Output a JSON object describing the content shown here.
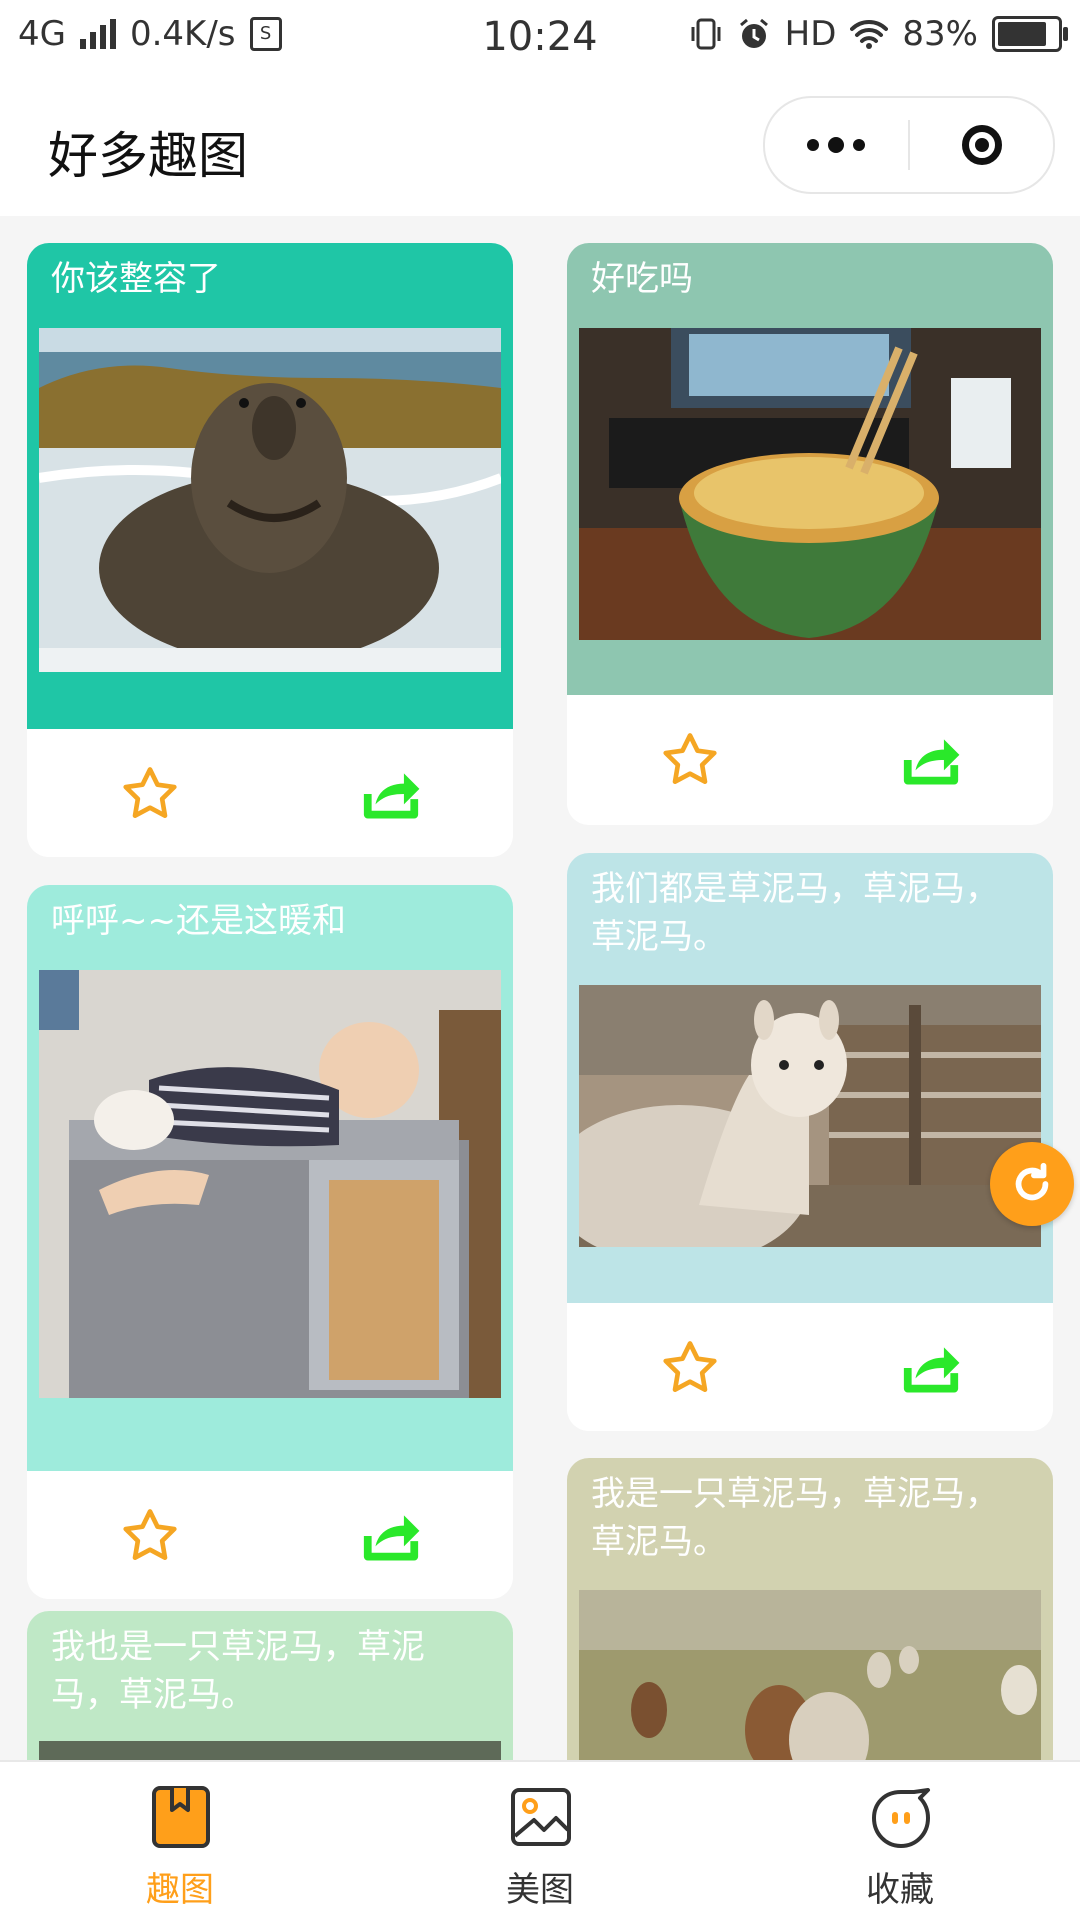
{
  "status_bar": {
    "network": "4G",
    "speed": "0.4K/s",
    "time": "10:24",
    "hd": "HD",
    "battery": "83%",
    "battery_level": 0.83
  },
  "header": {
    "title": "好多趣图"
  },
  "cards": [
    {
      "caption": "你该整容了",
      "color": "#1fc6a6"
    },
    {
      "caption": "好吃吗",
      "color": "#8ec6b0"
    },
    {
      "caption": "呼呼~~还是这暖和",
      "color": "#9eebdc"
    },
    {
      "caption": "我们都是草泥马，草泥马，草泥马。",
      "color": "#bde4e7"
    },
    {
      "caption": "我也是一只草泥马，草泥马，草泥马。",
      "color": "#bfe8c6"
    },
    {
      "caption": "我是一只草泥马，草泥马，草泥马。",
      "color": "#d2d2b0"
    }
  ],
  "icons": {
    "favorite": "star-icon",
    "share": "share-icon",
    "refresh": "refresh-icon"
  },
  "colors": {
    "accent": "#ff9f1a",
    "share_green": "#2ae82a",
    "star_orange": "#f5a623"
  },
  "tabs": [
    {
      "label": "趣图",
      "active": true,
      "color": "#ff9f1a"
    },
    {
      "label": "美图",
      "active": false,
      "color": "#333333"
    },
    {
      "label": "收藏",
      "active": false,
      "color": "#333333"
    }
  ]
}
